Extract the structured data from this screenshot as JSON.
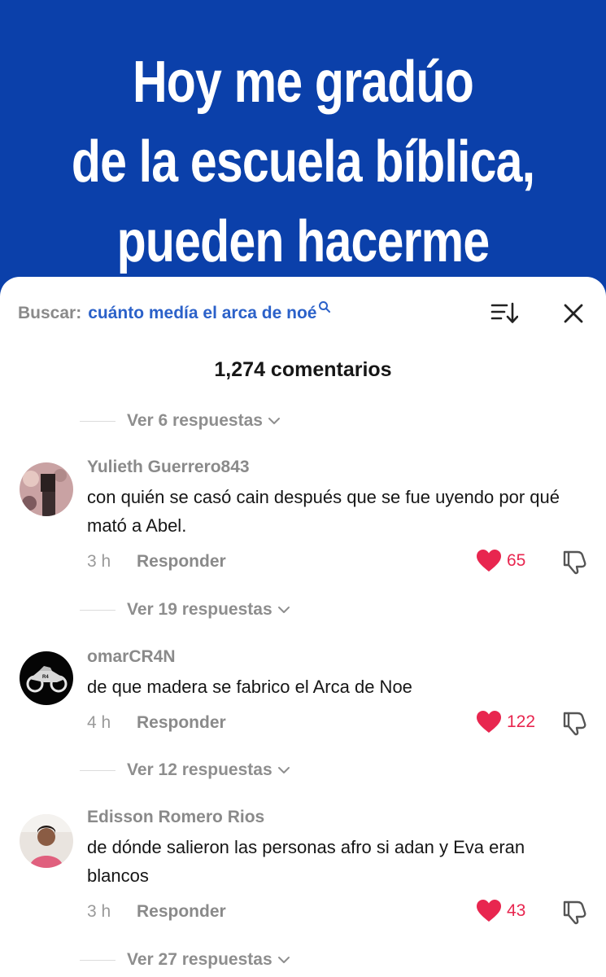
{
  "banner": {
    "line1": "Hoy me gradúo",
    "line2": "de la escuela bíblica,",
    "line3": "pueden hacerme"
  },
  "search": {
    "label": "Buscar:",
    "query": "cuánto medía el arca de noé"
  },
  "comments_count": "1,274 comentarios",
  "reply_threads": [
    "Ver 6 respuestas",
    "Ver 19 respuestas",
    "Ver 12 respuestas",
    "Ver 27 respuestas"
  ],
  "comments": [
    {
      "username": "Yulieth Guerrero843",
      "text": "con quién se casó cain después que se fue uyendo por qué mató a Abel.",
      "time": "3 h",
      "reply_label": "Responder",
      "likes": "65"
    },
    {
      "username": "omarCR4N",
      "text": "de que madera se fabrico el Arca de Noe",
      "time": "4 h",
      "reply_label": "Responder",
      "likes": "122"
    },
    {
      "username": "Edisson Romero Rios",
      "text": "de dónde salieron las personas afro si adan y Eva eran blancos",
      "time": "3 h",
      "reply_label": "Responder",
      "likes": "43"
    }
  ],
  "colors": {
    "banner_blue": "#0b40aa",
    "query_blue": "#2b61c9",
    "like_red": "#e8264f"
  },
  "icons": [
    "search-mini-icon",
    "sort-icon",
    "close-icon",
    "chevron-down-icon",
    "heart-icon",
    "dislike-icon"
  ]
}
